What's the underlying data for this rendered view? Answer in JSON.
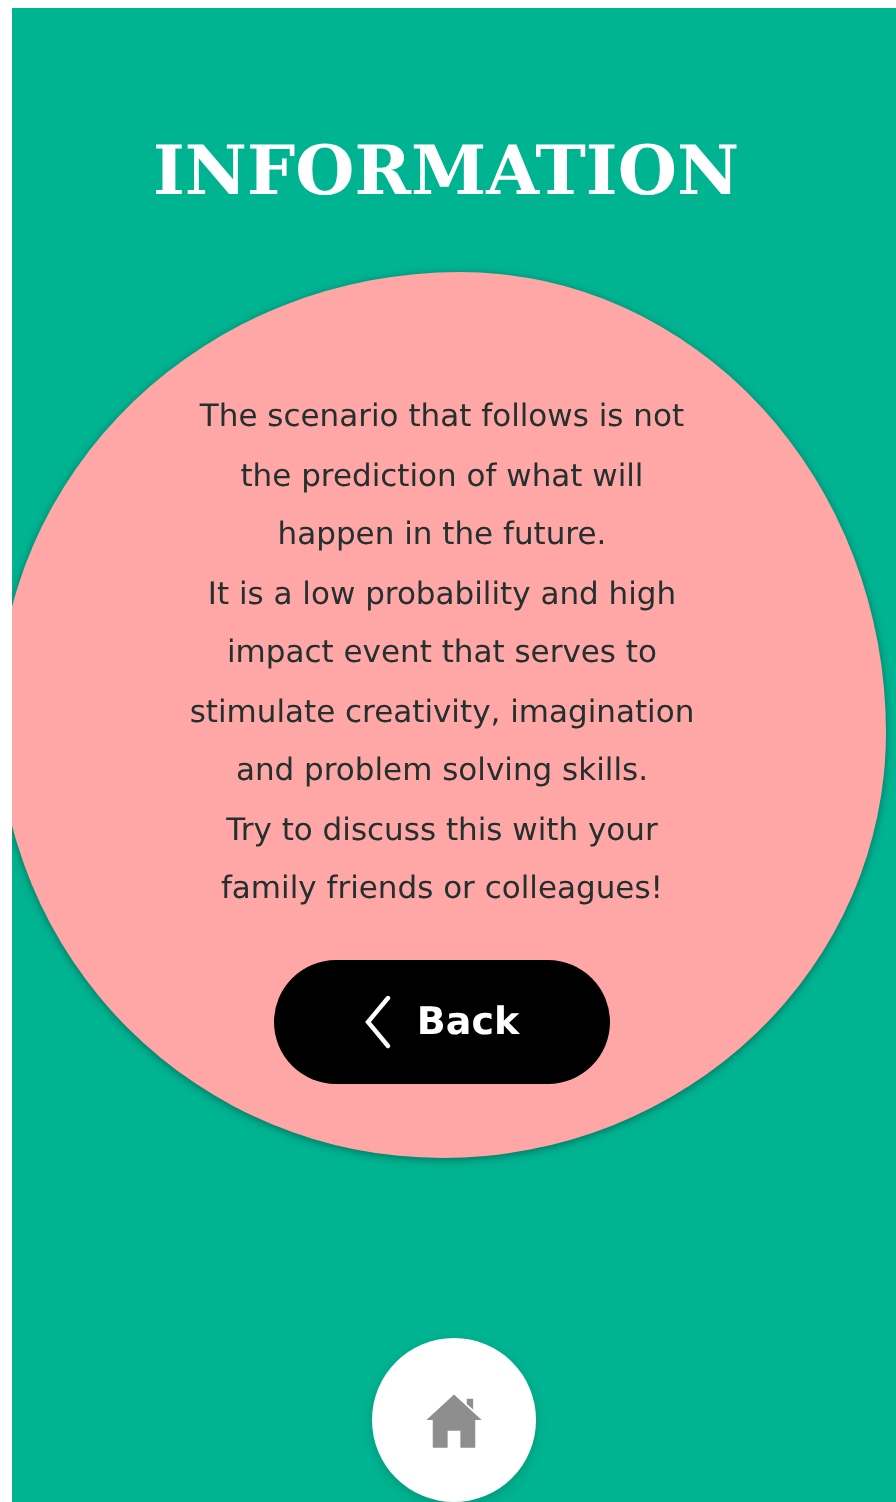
{
  "title": "INFORMATION",
  "message": "The scenario that follows is not\nthe prediction of what will\nhappen in the future.\nIt is a low probability and high\nimpact event that serves to\nstimulate creativity, imagination\nand problem solving skills.\nTry to discuss this with your\nfamily friends or colleagues!",
  "back_button": {
    "label": "Back"
  }
}
